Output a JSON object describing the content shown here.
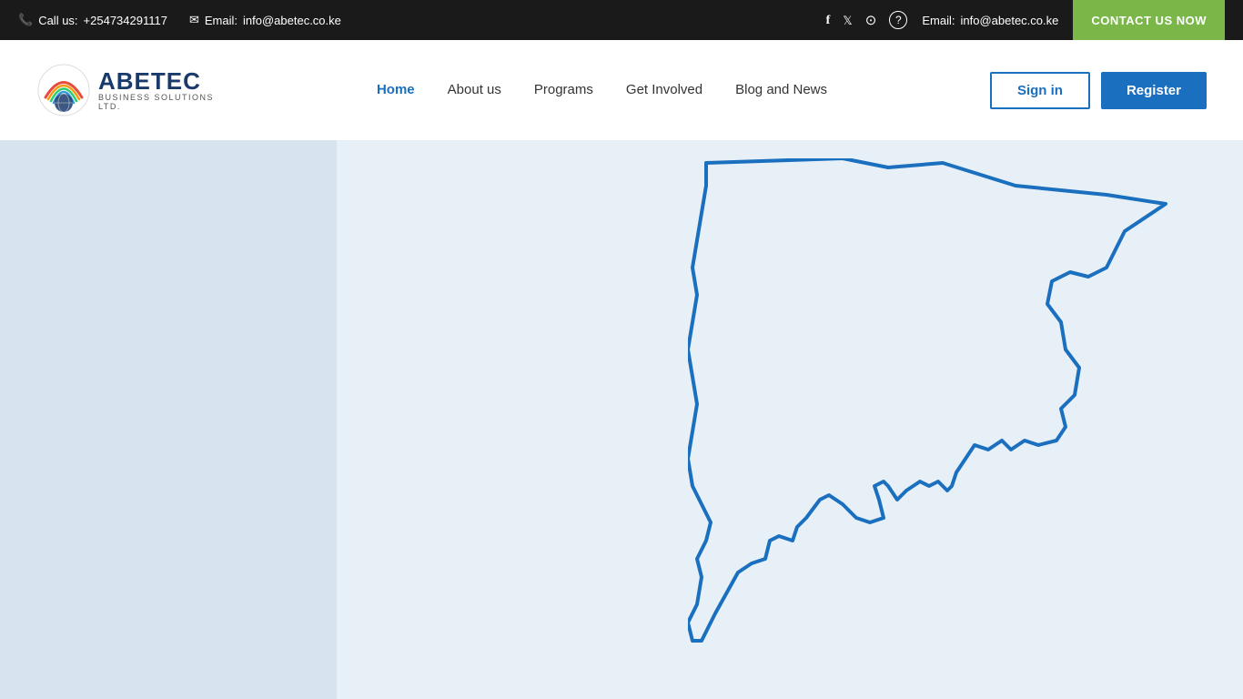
{
  "topbar": {
    "phone_label": "Call us:",
    "phone_number": "+254734291117",
    "email_label": "Email:",
    "email_address": "info@abetec.co.ke",
    "email_right_label": "Email:",
    "email_right_address": "info@abetec.co.ke",
    "contact_btn": "CONTACT US NOW"
  },
  "navbar": {
    "logo_main": "ABETEC",
    "logo_sub": "BUSINESS SOLUTIONS",
    "logo_sub2": "LTD.",
    "nav_items": [
      {
        "label": "Home",
        "active": true
      },
      {
        "label": "About us",
        "active": false
      },
      {
        "label": "Programs",
        "active": false
      },
      {
        "label": "Get Involved",
        "active": false
      },
      {
        "label": "Blog and News",
        "active": false
      }
    ],
    "sign_in": "Sign in",
    "register": "Register"
  },
  "hero": {
    "background_color": "#e8f0f7"
  }
}
